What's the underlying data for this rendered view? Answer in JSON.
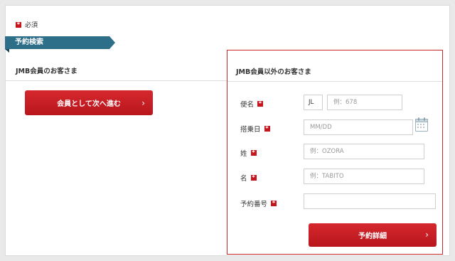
{
  "legend": {
    "required_text": "必須"
  },
  "section_tab": {
    "label": "予約検索"
  },
  "jmb": {
    "heading": "JMB会員のお客さま",
    "button_label": "会員として次へ進む"
  },
  "guest": {
    "heading": "JMB会員以外のお客さま",
    "fields": {
      "flight": {
        "label": "便名",
        "prefix": "JL",
        "placeholder": "例：678"
      },
      "date": {
        "label": "搭乗日",
        "placeholder": "MM/DD"
      },
      "last_name": {
        "label": "姓",
        "placeholder": "例：OZORA"
      },
      "first_name": {
        "label": "名",
        "placeholder": "例：TABITO"
      },
      "reservation_no": {
        "label": "予約番号",
        "placeholder": ""
      }
    },
    "submit_label": "予約詳細"
  },
  "icons": {
    "required": "required-mark-icon",
    "calendar": "calendar-icon",
    "chevron": "chevron-right-icon"
  },
  "colors": {
    "accent_red": "#c4161c",
    "tab_blue": "#2d6e88",
    "panel_border": "#c9252b"
  }
}
